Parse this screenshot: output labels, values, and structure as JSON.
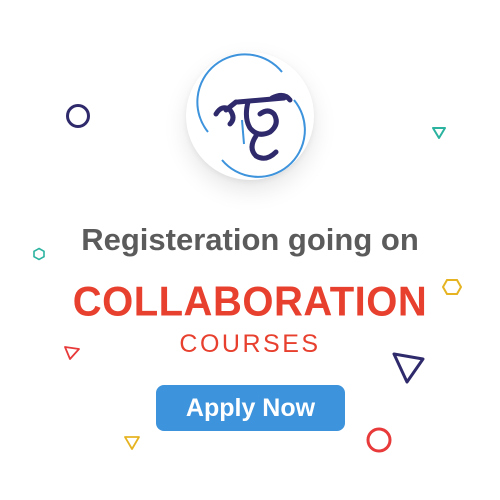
{
  "logo": {
    "icon": "calligraphy-logo-icon"
  },
  "headline": "Registeration going on",
  "title": "COLLABORATION",
  "subtitle": "COURSES",
  "cta": {
    "label": "Apply Now"
  },
  "colors": {
    "headline": "#5b5b5b",
    "title": "#e8402e",
    "button": "#3d93dc",
    "navy": "#2f2a6b",
    "red": "#e83a3a",
    "teal": "#2bb3a0",
    "gold": "#e6b422"
  }
}
